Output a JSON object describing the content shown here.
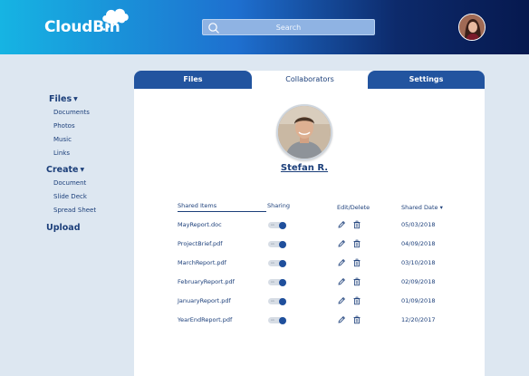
{
  "header": {
    "logo": "CloudBin",
    "search_placeholder": "Search"
  },
  "sidebar": {
    "files_label": "Files",
    "files_items": [
      "Documents",
      "Photos",
      "Music",
      "Links"
    ],
    "create_label": "Create",
    "create_items": [
      "Document",
      "Slide Deck",
      "Spread Sheet"
    ],
    "upload_label": "Upload"
  },
  "tabs": [
    "Files",
    "Collaborators",
    "Settings"
  ],
  "active_tab": "Collaborators",
  "profile": {
    "name": "Stefan R."
  },
  "table": {
    "headers": [
      "Shared Items",
      "Sharing",
      "Edit/Delete",
      "Shared Date"
    ],
    "sort_indicator": "▾",
    "rows": [
      {
        "item": "MayReport.doc",
        "sharing": "on",
        "date": "05/03/2018"
      },
      {
        "item": "ProjectBrief.pdf",
        "sharing": "on",
        "date": "04/09/2018"
      },
      {
        "item": "MarchReport.pdf",
        "sharing": "on",
        "date": "03/10/2018"
      },
      {
        "item": "FebruaryReport.pdf",
        "sharing": "on",
        "date": "02/09/2018"
      },
      {
        "item": "JanuaryReport.pdf",
        "sharing": "on",
        "date": "01/09/2018"
      },
      {
        "item": "YearEndReport.pdf",
        "sharing": "on",
        "date": "12/20/2017"
      }
    ]
  },
  "colors": {
    "primary": "#22549f",
    "text": "#1c3f7a",
    "background": "#dde7f1"
  }
}
